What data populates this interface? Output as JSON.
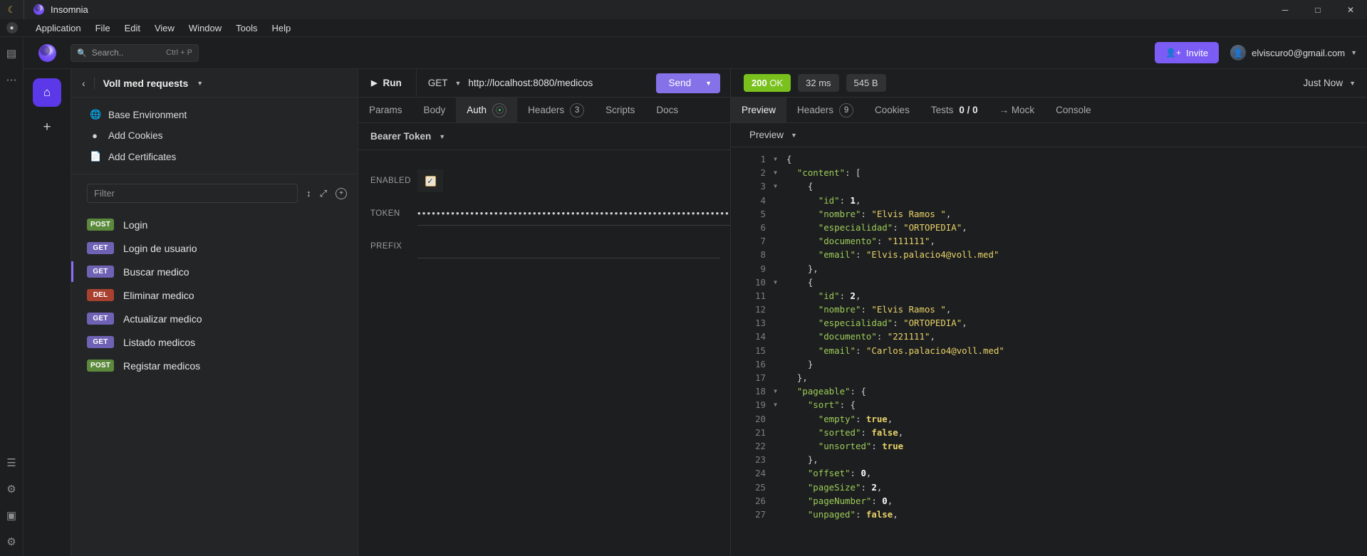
{
  "titlebar": {
    "app_name": "Insomnia",
    "key_icon": "key-icon",
    "minimize": "─",
    "maximize": "□",
    "close": "✕"
  },
  "menubar": {
    "items": [
      "Application",
      "File",
      "Edit",
      "View",
      "Window",
      "Tools",
      "Help"
    ]
  },
  "rail": {
    "icons": [
      "grid-icon",
      "dots-icon",
      "layers-icon",
      "gear-icon",
      "monitor-icon",
      "flask-icon"
    ]
  },
  "appheader": {
    "search": {
      "placeholder": "Search..",
      "shortcut": "Ctrl + P"
    },
    "invite_label": "Invite",
    "account_email": "elviscuro0@gmail.com"
  },
  "sidebar": {
    "workspace": "Voll med requests",
    "meta_items": [
      {
        "label": "Base Environment",
        "icon": "globe-icon"
      },
      {
        "label": "Add Cookies",
        "icon": "cookie-icon"
      },
      {
        "label": "Add Certificates",
        "icon": "certificate-icon"
      }
    ],
    "filter_placeholder": "Filter",
    "requests": [
      {
        "method": "POST",
        "name": "Login",
        "active": false
      },
      {
        "method": "GET",
        "name": "Login de usuario",
        "active": false
      },
      {
        "method": "GET",
        "name": "Buscar medico",
        "active": true
      },
      {
        "method": "DEL",
        "name": "Eliminar medico",
        "active": false
      },
      {
        "method": "GET",
        "name": "Actualizar medico",
        "active": false
      },
      {
        "method": "GET",
        "name": "Listado medicos",
        "active": false
      },
      {
        "method": "POST",
        "name": "Registar medicos",
        "active": false
      }
    ]
  },
  "request": {
    "run_label": "Run",
    "method": "GET",
    "url": "http://localhost:8080/medicos",
    "send_label": "Send",
    "tabs": [
      {
        "label": "Params",
        "badge": "",
        "dot": false,
        "active": false
      },
      {
        "label": "Body",
        "badge": "",
        "dot": false,
        "active": false
      },
      {
        "label": "Auth",
        "badge": "",
        "dot": true,
        "active": true
      },
      {
        "label": "Headers",
        "badge": "3",
        "dot": false,
        "active": false
      },
      {
        "label": "Scripts",
        "badge": "",
        "dot": false,
        "active": false
      },
      {
        "label": "Docs",
        "badge": "",
        "dot": false,
        "active": false
      }
    ],
    "auth": {
      "type": "Bearer Token",
      "enabled_label": "ENABLED",
      "enabled_checked": "✓",
      "token_label": "TOKEN",
      "token_value": "••••••••••••••••••••••••••••••••••••••••••••••••••••••••••••••••••••••••••••••••••••••••••••",
      "prefix_label": "PREFIX",
      "prefix_value": ""
    }
  },
  "response": {
    "status_code": "200",
    "status_text": "OK",
    "time": "32 ms",
    "size": "545 B",
    "when": "Just Now",
    "tabs": [
      {
        "label": "Preview",
        "badge": "",
        "active": true
      },
      {
        "label": "Headers",
        "badge": "9",
        "active": false
      },
      {
        "label": "Cookies",
        "badge": "",
        "active": false
      },
      {
        "label": "Tests",
        "badge": "",
        "suffix": "0 / 0",
        "active": false
      },
      {
        "label": "→ Mock",
        "badge": "",
        "active": false
      },
      {
        "label": "Console",
        "badge": "",
        "active": false
      }
    ],
    "preview_mode": "Preview",
    "json_lines": [
      {
        "n": 1,
        "fold": true,
        "code": "{"
      },
      {
        "n": 2,
        "fold": true,
        "code": "  \"content\": ["
      },
      {
        "n": 3,
        "fold": true,
        "code": "    {"
      },
      {
        "n": 4,
        "fold": false,
        "code": "      \"id\": 1,"
      },
      {
        "n": 5,
        "fold": false,
        "code": "      \"nombre\": \"Elvis Ramos \","
      },
      {
        "n": 6,
        "fold": false,
        "code": "      \"especialidad\": \"ORTOPEDIA\","
      },
      {
        "n": 7,
        "fold": false,
        "code": "      \"documento\": \"111111\","
      },
      {
        "n": 8,
        "fold": false,
        "code": "      \"email\": \"Elvis.palacio4@voll.med\""
      },
      {
        "n": 9,
        "fold": false,
        "code": "    },"
      },
      {
        "n": 10,
        "fold": true,
        "code": "    {"
      },
      {
        "n": 11,
        "fold": false,
        "code": "      \"id\": 2,"
      },
      {
        "n": 12,
        "fold": false,
        "code": "      \"nombre\": \"Elvis Ramos \","
      },
      {
        "n": 13,
        "fold": false,
        "code": "      \"especialidad\": \"ORTOPEDIA\","
      },
      {
        "n": 14,
        "fold": false,
        "code": "      \"documento\": \"221111\","
      },
      {
        "n": 15,
        "fold": false,
        "code": "      \"email\": \"Carlos.palacio4@voll.med\""
      },
      {
        "n": 16,
        "fold": false,
        "code": "    }"
      },
      {
        "n": 17,
        "fold": false,
        "code": "  },"
      },
      {
        "n": 18,
        "fold": true,
        "code": "  \"pageable\": {"
      },
      {
        "n": 19,
        "fold": true,
        "code": "    \"sort\": {"
      },
      {
        "n": 20,
        "fold": false,
        "code": "      \"empty\": true,"
      },
      {
        "n": 21,
        "fold": false,
        "code": "      \"sorted\": false,"
      },
      {
        "n": 22,
        "fold": false,
        "code": "      \"unsorted\": true"
      },
      {
        "n": 23,
        "fold": false,
        "code": "    },"
      },
      {
        "n": 24,
        "fold": false,
        "code": "    \"offset\": 0,"
      },
      {
        "n": 25,
        "fold": false,
        "code": "    \"pageSize\": 2,"
      },
      {
        "n": 26,
        "fold": false,
        "code": "    \"pageNumber\": 0,"
      },
      {
        "n": 27,
        "fold": false,
        "code": "    \"unpaged\": false,"
      }
    ]
  }
}
